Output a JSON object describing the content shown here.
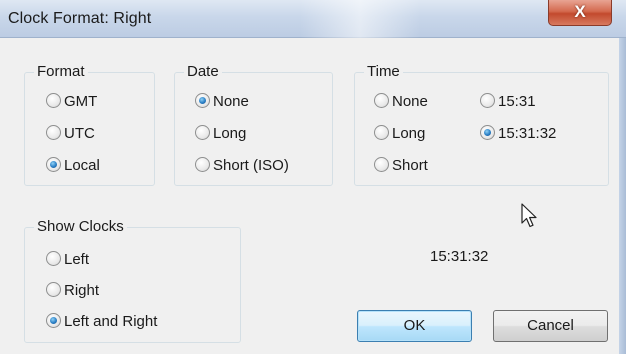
{
  "window": {
    "title": "Clock Format: Right",
    "close_glyph": "X"
  },
  "format": {
    "legend": "Format",
    "options": [
      {
        "label": "GMT",
        "checked": false
      },
      {
        "label": "UTC",
        "checked": false
      },
      {
        "label": "Local",
        "checked": true
      }
    ]
  },
  "date": {
    "legend": "Date",
    "options": [
      {
        "label": "None",
        "checked": true
      },
      {
        "label": "Long",
        "checked": false
      },
      {
        "label": "Short (ISO)",
        "checked": false
      }
    ]
  },
  "time": {
    "legend": "Time",
    "options": [
      {
        "label": "None",
        "checked": false
      },
      {
        "label": "Long",
        "checked": false
      },
      {
        "label": "Short",
        "checked": false
      },
      {
        "label": "15:31",
        "checked": false
      },
      {
        "label": "15:31:32",
        "checked": true
      }
    ]
  },
  "show_clocks": {
    "legend": "Show Clocks",
    "options": [
      {
        "label": "Left",
        "checked": false
      },
      {
        "label": "Right",
        "checked": false
      },
      {
        "label": "Left and Right",
        "checked": true
      }
    ]
  },
  "preview_time": "15:31:32",
  "buttons": {
    "ok": "OK",
    "cancel": "Cancel"
  },
  "colors": {
    "accent": "#2a7fc6",
    "close": "#c24a2e",
    "titlebar": "#c9d7ea"
  },
  "icons": {
    "cursor": "mouse-pointer-icon",
    "close": "close-icon"
  }
}
